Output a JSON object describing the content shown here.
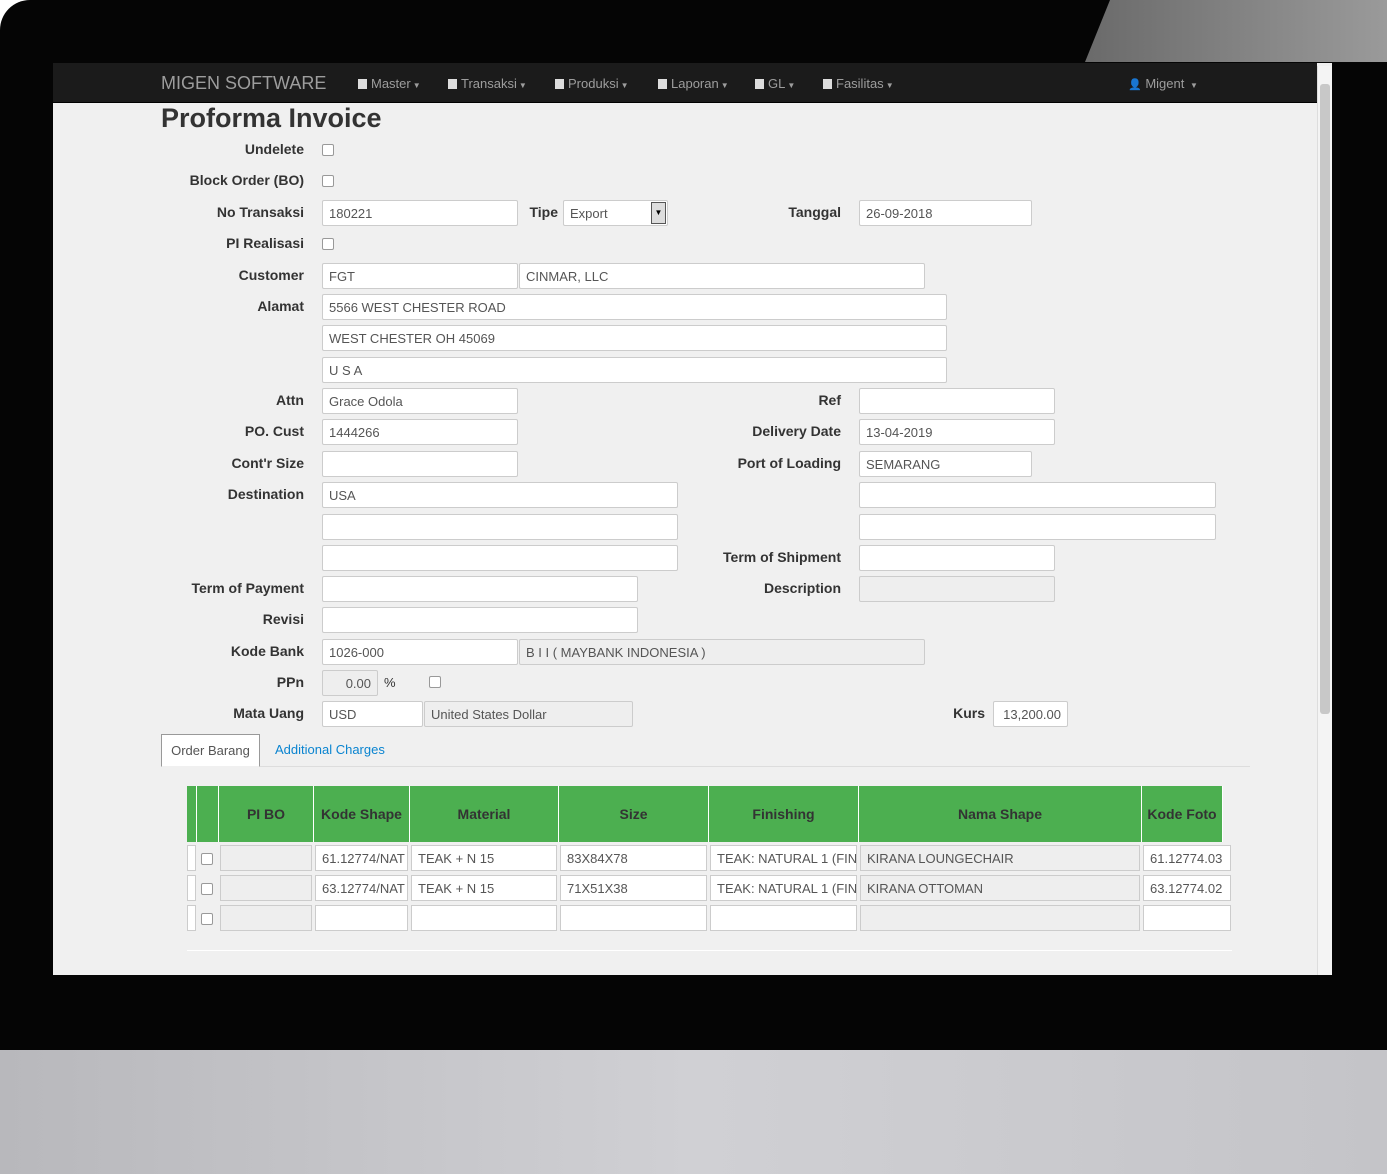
{
  "navbar": {
    "brand": "MIGEN SOFTWARE",
    "items": [
      {
        "label": "Master",
        "icon": "phone-icon"
      },
      {
        "label": "Transaksi",
        "icon": "list-icon"
      },
      {
        "label": "Produksi",
        "icon": "briefcase-icon"
      },
      {
        "label": "Laporan",
        "icon": "file-icon"
      },
      {
        "label": "GL",
        "icon": "file-icon"
      },
      {
        "label": "Fasilitas",
        "icon": "briefcase-icon"
      }
    ],
    "user": "Migent"
  },
  "page_title": "Proforma Invoice",
  "labels": {
    "undelete": "Undelete",
    "block_order": "Block Order (BO)",
    "no_transaksi": "No Transaksi",
    "tipe": "Tipe",
    "tanggal": "Tanggal",
    "pi_realisasi": "PI Realisasi",
    "customer": "Customer",
    "alamat": "Alamat",
    "attn": "Attn",
    "ref": "Ref",
    "po_cust": "PO. Cust",
    "delivery_date": "Delivery Date",
    "cont_size": "Cont'r Size",
    "port_of_loading": "Port of Loading",
    "destination": "Destination",
    "term_of_shipment": "Term of Shipment",
    "term_of_payment": "Term of Payment",
    "description": "Description",
    "revisi": "Revisi",
    "kode_bank": "Kode Bank",
    "ppn": "PPn",
    "percent": "%",
    "mata_uang": "Mata Uang",
    "kurs": "Kurs"
  },
  "values": {
    "no_transaksi": "180221",
    "tipe": "Export",
    "tanggal": "26-09-2018",
    "customer_code": "FGT",
    "customer_name": "CINMAR, LLC",
    "alamat1": "5566 WEST CHESTER ROAD",
    "alamat2": "WEST CHESTER OH 45069",
    "alamat3": "U S A",
    "attn": "Grace Odola",
    "ref": "",
    "po_cust": "1444266",
    "delivery_date": "13-04-2019",
    "cont_size": "",
    "port_of_loading": "SEMARANG",
    "destination1": "USA",
    "destination2": "",
    "destination3": "",
    "dest_right1": "",
    "dest_right2": "",
    "term_of_shipment": "",
    "term_of_payment": "",
    "description": "",
    "revisi": "",
    "kode_bank": "1026-000",
    "bank_name": "B I I ( MAYBANK INDONESIA )",
    "ppn": "0.00",
    "mata_uang": "USD",
    "mata_uang_name": "United States Dollar",
    "kurs": "13,200.00"
  },
  "tabs": [
    {
      "label": "Order Barang",
      "active": true
    },
    {
      "label": "Additional Charges",
      "active": false
    }
  ],
  "table": {
    "header_color": "#4caf50",
    "columns": [
      "",
      "",
      "PI BO",
      "Kode Shape",
      "Material",
      "Size",
      "Finishing",
      "Nama Shape",
      "Kode Foto"
    ],
    "rows": [
      [
        "",
        "61.12774/NAT",
        "TEAK + N 15",
        "83X84X78",
        "TEAK: NATURAL 1 (FIN",
        "KIRANA LOUNGECHAIR",
        "61.12774.03"
      ],
      [
        "",
        "63.12774/NAT",
        "TEAK + N 15",
        "71X51X38",
        "TEAK: NATURAL 1 (FIN",
        "KIRANA OTTOMAN",
        "63.12774.02"
      ],
      [
        "",
        "",
        "",
        "",
        "",
        "",
        ""
      ]
    ]
  }
}
